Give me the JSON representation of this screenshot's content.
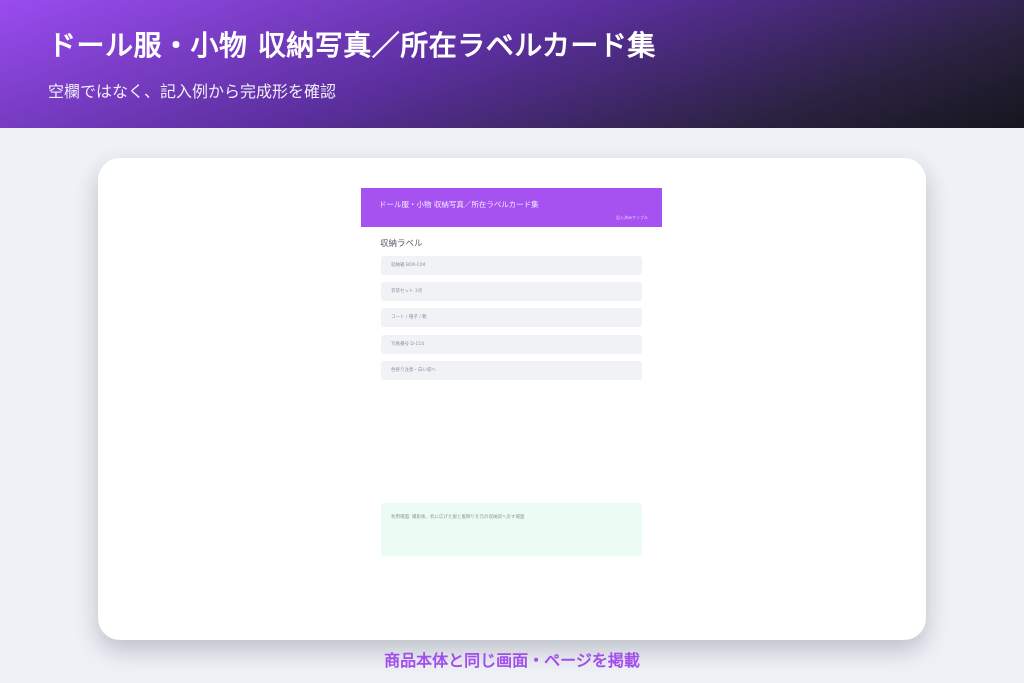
{
  "hero": {
    "title": "ドール服・小物 収納写真／所在ラベルカード集",
    "subtitle": "空欄ではなく、記入例から完成形を確認"
  },
  "document": {
    "header_title": "ドール服・小物 収納写真／所在ラベルカード集",
    "sample_note": "記入済みサンプル",
    "section_title": "収納ラベル",
    "fields": [
      {
        "label": "収納箱 BOX-C04"
      },
      {
        "label": "衣装セット 3点"
      },
      {
        "label": "コート / 帽子 / 靴"
      },
      {
        "label": "写真番号 D-114"
      },
      {
        "label": "色移り注意・白い袋へ"
      }
    ],
    "memo": "利用場面: 撮影後、机に広げた服と髪飾りを元の収納袋へ戻す場面"
  },
  "footer": {
    "caption": "商品本体と同じ画面・ページを掲載"
  }
}
